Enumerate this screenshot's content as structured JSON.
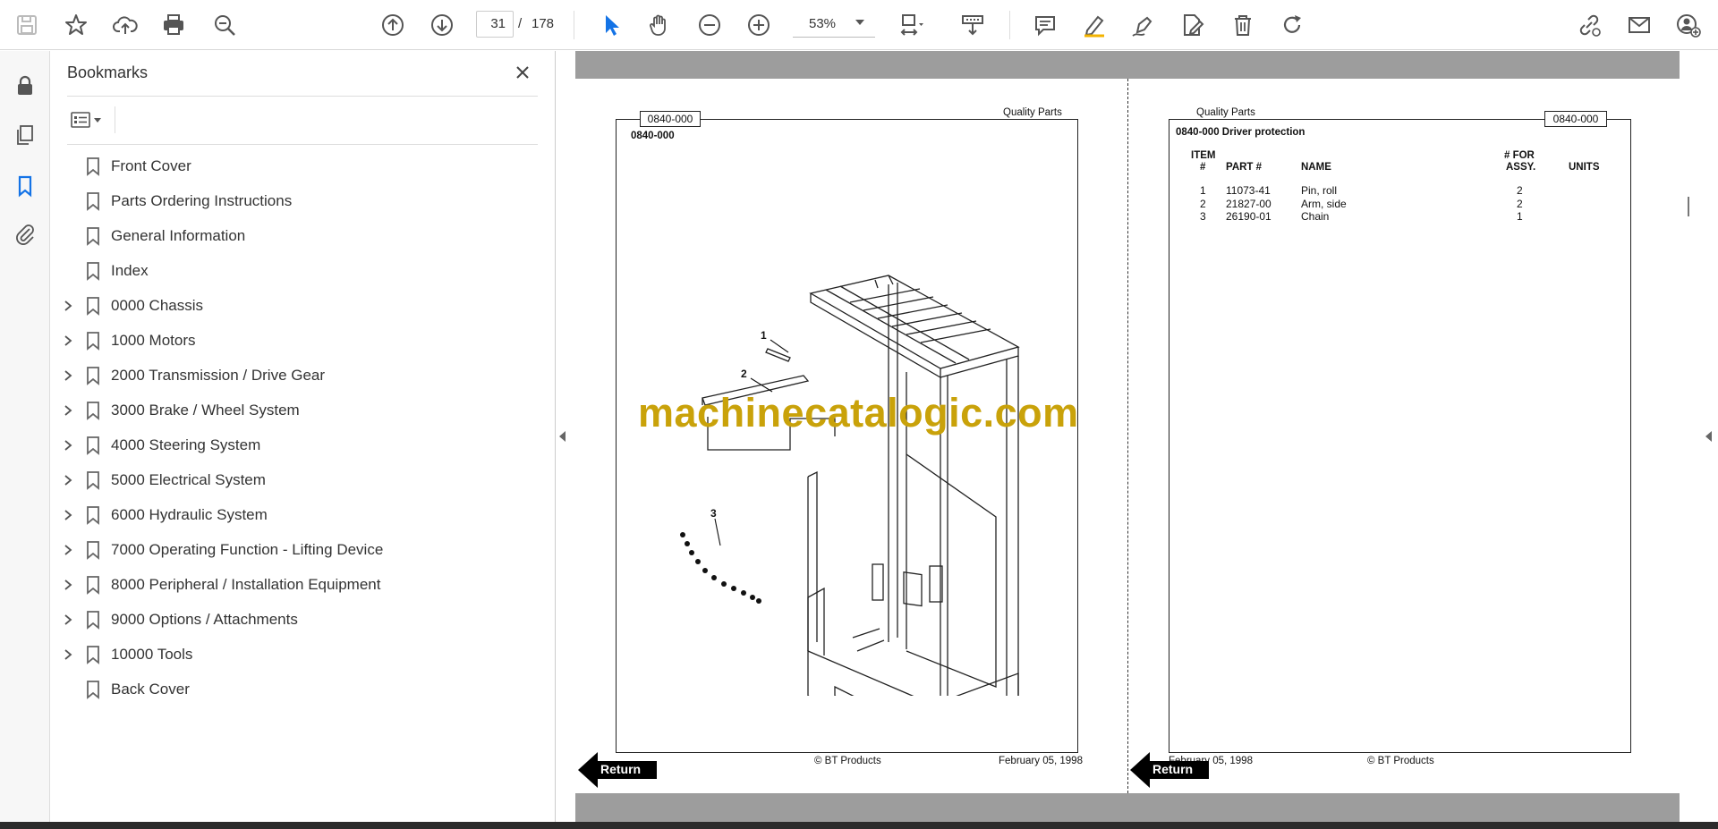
{
  "toolbar": {
    "current_page": "31",
    "page_separator": "/",
    "total_pages": "178",
    "zoom": "53%"
  },
  "panel": {
    "title": "Bookmarks",
    "bookmarks": [
      {
        "label": "Front Cover",
        "expandable": false
      },
      {
        "label": "Parts Ordering Instructions",
        "expandable": false
      },
      {
        "label": "General Information",
        "expandable": false
      },
      {
        "label": "Index",
        "expandable": false
      },
      {
        "label": "0000 Chassis",
        "expandable": true
      },
      {
        "label": "1000 Motors",
        "expandable": true
      },
      {
        "label": "2000 Transmission / Drive Gear",
        "expandable": true
      },
      {
        "label": "3000 Brake / Wheel System",
        "expandable": true
      },
      {
        "label": "4000 Steering System",
        "expandable": true
      },
      {
        "label": "5000 Electrical System",
        "expandable": true
      },
      {
        "label": "6000 Hydraulic System",
        "expandable": true
      },
      {
        "label": "7000 Operating Function - Lifting Device",
        "expandable": true
      },
      {
        "label": "8000 Peripheral / Installation Equipment",
        "expandable": true
      },
      {
        "label": "9000 Options / Attachments",
        "expandable": true
      },
      {
        "label": "10000 Tools",
        "expandable": true
      },
      {
        "label": "Back Cover",
        "expandable": false
      }
    ]
  },
  "doc": {
    "left_page": {
      "tag": "0840-000",
      "header_right": "Quality Parts",
      "section_code": "0840-000",
      "callouts": [
        "1",
        "2",
        "3"
      ],
      "footer_copyright": "© BT Products",
      "footer_date": "February 05, 1998",
      "return_label": "Return"
    },
    "right_page": {
      "tag": "0840-000",
      "header_left": "Quality Parts",
      "section_title": "0840-000 Driver protection",
      "columns": {
        "item_top": "ITEM",
        "item_bottom": "#",
        "part": "PART #",
        "name": "NAME",
        "for_top": "# FOR",
        "for_bottom": "ASSY.",
        "units": "UNITS"
      },
      "rows": [
        {
          "item": "1",
          "part": "11073-41",
          "name": "Pin, roll",
          "qty": "2"
        },
        {
          "item": "2",
          "part": "21827-00",
          "name": "Arm, side",
          "qty": "2"
        },
        {
          "item": "3",
          "part": "26190-01",
          "name": "Chain",
          "qty": "1"
        }
      ],
      "footer_date": "February 05, 1998",
      "footer_copyright": "© BT Products",
      "return_label": "Return"
    },
    "watermark": "machinecatalogic.com"
  }
}
